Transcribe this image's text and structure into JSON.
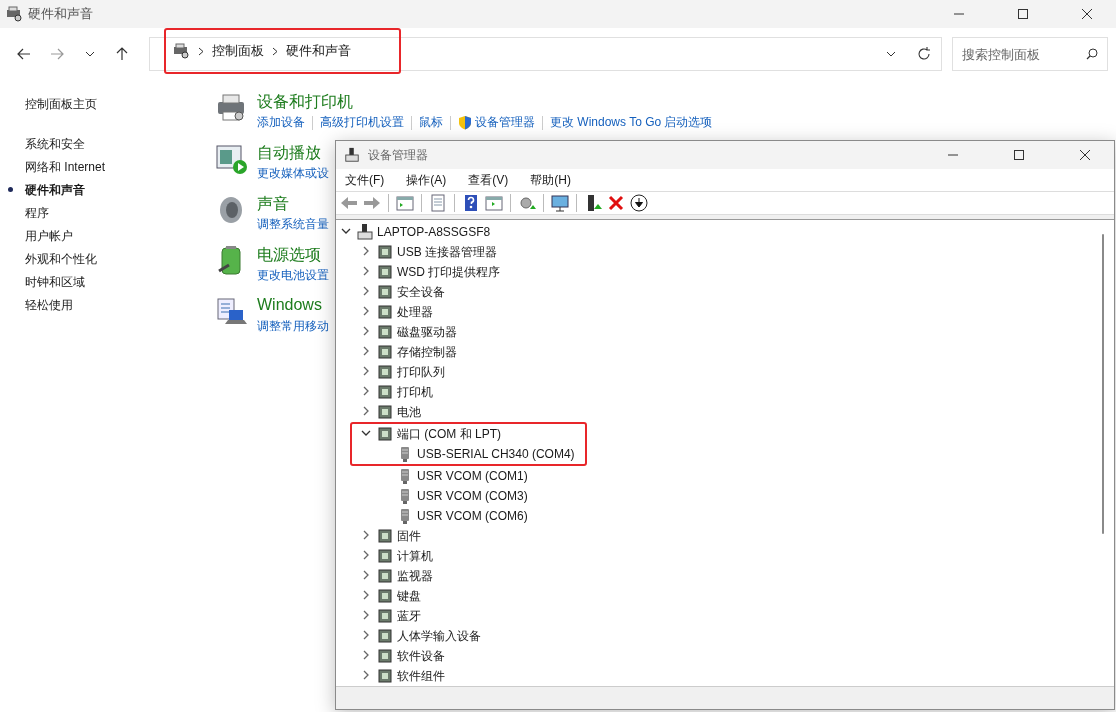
{
  "window": {
    "title": "硬件和声音"
  },
  "address": {
    "breadcrumb": [
      "控制面板",
      "硬件和声音"
    ],
    "highlighted": true
  },
  "search": {
    "placeholder": "搜索控制面板"
  },
  "sidebar": {
    "home": "控制面板主页",
    "items": [
      {
        "label": "系统和安全",
        "selected": false
      },
      {
        "label": "网络和 Internet",
        "selected": false
      },
      {
        "label": "硬件和声音",
        "selected": true
      },
      {
        "label": "程序",
        "selected": false
      },
      {
        "label": "用户帐户",
        "selected": false
      },
      {
        "label": "外观和个性化",
        "selected": false
      },
      {
        "label": "时钟和区域",
        "selected": false
      },
      {
        "label": "轻松使用",
        "selected": false
      }
    ]
  },
  "categories": [
    {
      "title": "设备和打印机",
      "links": [
        {
          "label": "添加设备",
          "kind": "plain"
        },
        {
          "label": "高级打印机设置",
          "kind": "plain"
        },
        {
          "label": "鼠标",
          "kind": "plain"
        },
        {
          "label": "设备管理器",
          "kind": "admin"
        },
        {
          "label": "更改 Windows To Go 启动选项",
          "kind": "plain"
        }
      ]
    },
    {
      "title": "自动播放",
      "links": [
        {
          "label": "更改媒体或设",
          "kind": "plain"
        }
      ]
    },
    {
      "title": "声音",
      "links": [
        {
          "label": "调整系统音量",
          "kind": "plain"
        }
      ]
    },
    {
      "title": "电源选项",
      "links": [
        {
          "label": "更改电池设置",
          "kind": "plain"
        }
      ]
    },
    {
      "title": "Windows",
      "links": [
        {
          "label": "调整常用移动",
          "kind": "plain"
        }
      ]
    }
  ],
  "device_manager": {
    "title": "设备管理器",
    "menu": [
      "文件(F)",
      "操作(A)",
      "查看(V)",
      "帮助(H)"
    ],
    "tree": {
      "label": "LAPTOP-A8SSGSF8",
      "expanded": true,
      "children": [
        {
          "label": "USB 连接器管理器",
          "expanded": false
        },
        {
          "label": "WSD 打印提供程序",
          "expanded": false
        },
        {
          "label": "安全设备",
          "expanded": false
        },
        {
          "label": "处理器",
          "expanded": false
        },
        {
          "label": "磁盘驱动器",
          "expanded": false
        },
        {
          "label": "存储控制器",
          "expanded": false
        },
        {
          "label": "打印队列",
          "expanded": false
        },
        {
          "label": "打印机",
          "expanded": false
        },
        {
          "label": "电池",
          "expanded": false
        },
        {
          "label": "端口 (COM 和 LPT)",
          "expanded": true,
          "highlighted": true,
          "children": [
            {
              "label": "USB-SERIAL CH340 (COM4)"
            },
            {
              "label": "USR VCOM (COM1)"
            },
            {
              "label": "USR VCOM (COM3)"
            },
            {
              "label": "USR VCOM (COM6)"
            }
          ]
        },
        {
          "label": "固件",
          "expanded": false
        },
        {
          "label": "计算机",
          "expanded": false
        },
        {
          "label": "监视器",
          "expanded": false
        },
        {
          "label": "键盘",
          "expanded": false
        },
        {
          "label": "蓝牙",
          "expanded": false
        },
        {
          "label": "人体学输入设备",
          "expanded": false
        },
        {
          "label": "软件设备",
          "expanded": false
        },
        {
          "label": "软件组件",
          "expanded": false
        }
      ]
    }
  }
}
